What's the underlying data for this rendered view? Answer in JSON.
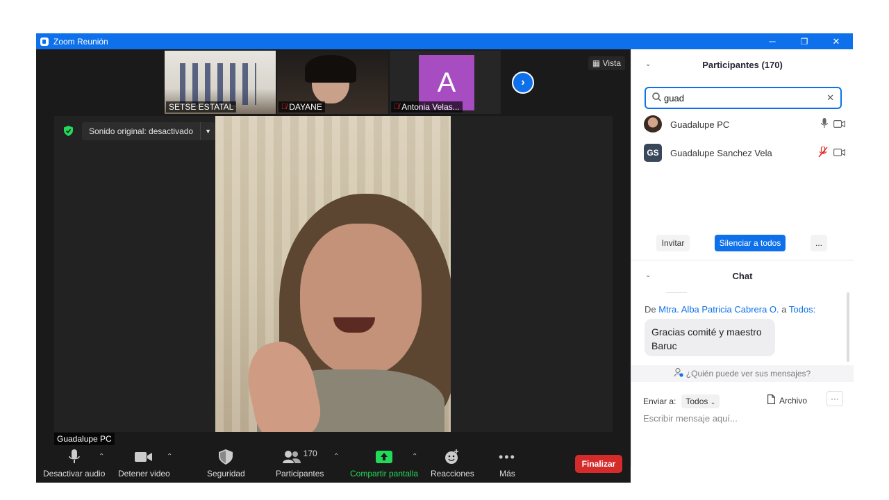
{
  "window": {
    "title": "Zoom Reunión",
    "minimize": "─",
    "restore": "❐",
    "close": "✕"
  },
  "strip": {
    "tiles": [
      {
        "label": "SETSE ESTATAL"
      },
      {
        "label": "DAYANE"
      },
      {
        "label": "Antonia Velas...",
        "initial": "A"
      }
    ],
    "view_label": "Vista"
  },
  "main_video": {
    "sound_label": "Sonido original: desactivado",
    "name": "Guadalupe PC"
  },
  "toolbar": {
    "audio": "Desactivar audio",
    "video": "Detener video",
    "security": "Seguridad",
    "participants": "Participantes",
    "participants_count": "170",
    "share": "Compartir pantalla",
    "reactions": "Reacciones",
    "more": "Más",
    "end": "Finalizar"
  },
  "participants_panel": {
    "title": "Participantes (170)",
    "search_value": "guad",
    "list": [
      {
        "name": "Guadalupe PC"
      },
      {
        "name": "Guadalupe Sanchez Vela",
        "initials": "GS"
      }
    ],
    "invite": "Invitar",
    "mute_all": "Silenciar a todos",
    "more": "..."
  },
  "chat": {
    "title": "Chat",
    "from_prefix": "De",
    "from_name": "Mtra. Alba Patricia Cabrera O.",
    "to_text": "a",
    "to_name": "Todos:",
    "message": "Gracias comité y maestro Baruc",
    "who_can_see": "¿Quién puede ver sus mensajes?",
    "send_to_label": "Enviar a:",
    "send_to_value": "Todos",
    "file": "Archivo",
    "more": "···",
    "input_placeholder": "Escribir mensaje aquí..."
  },
  "colors": {
    "zoom_blue": "#0e71eb",
    "end_red": "#d62b2b",
    "share_green": "#23d959"
  }
}
